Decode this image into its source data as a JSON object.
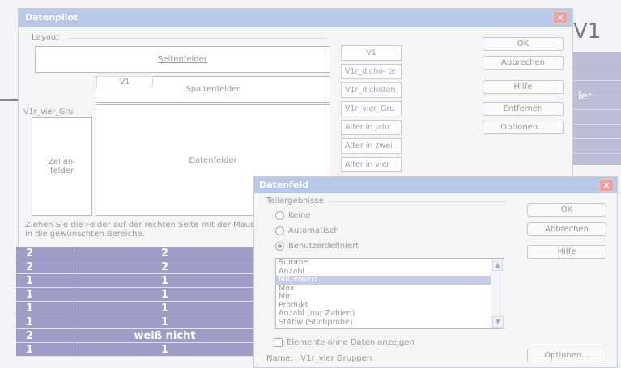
{
  "background": {
    "sheet_header": "V1",
    "sheet_col_text": "ler",
    "table_rows": [
      {
        "c1": "2",
        "c2": "2"
      },
      {
        "c1": "2",
        "c2": "2"
      },
      {
        "c1": "1",
        "c2": "1"
      },
      {
        "c1": "1",
        "c2": "1"
      },
      {
        "c1": "1",
        "c2": "1"
      },
      {
        "c1": "1",
        "c2": "1"
      },
      {
        "c1": "2",
        "c2": "weiß nicht"
      },
      {
        "c1": "1",
        "c2": "1"
      }
    ]
  },
  "datenpilot": {
    "title": "Datenpilot",
    "layout_label": "Layout",
    "seitenfelder": "Seitenfelder",
    "spaltenfelder": "Spaltenfelder",
    "column_field_item": "V1",
    "row_field_item": "V1r_vier_Gru",
    "zeilenfelder": "Zeilen-\nfelder",
    "datenfelder": "Datenfelder",
    "hint": "Ziehen Sie die Felder auf der rechten Seite mit der Maus in die gewünschten Bereiche.",
    "field_buttons": [
      "V1",
      "V1r_dicho- te",
      "V1r_dichoton",
      "V1r_vier_Gru",
      "Alter in Jahr",
      "Alter in zwei",
      "Alter in vier"
    ],
    "buttons": {
      "ok": "OK",
      "abbrechen": "Abbrechen",
      "hilfe": "Hilfe",
      "entfernen": "Entfernen",
      "optionen": "Optionen..."
    }
  },
  "datenfeld": {
    "title": "Datenfeld",
    "teilergebnisse": "Teilergebnisse",
    "radio_keine": "Keine",
    "radio_automatisch": "Automatisch",
    "radio_benutzer": "Benutzerdefiniert",
    "list_items": [
      "Summe",
      "Anzahl",
      "Mittelwert",
      "Max",
      "Min",
      "Produkt",
      "Anzahl (nur Zahlen)",
      "StAbw (Stichprobe)"
    ],
    "selected_item": "Mittelwert",
    "checkbox_label": "Elemente ohne Daten anzeigen",
    "name_label": "Name:",
    "name_value": "V1r_vier Gruppen",
    "buttons": {
      "ok": "OK",
      "abbrechen": "Abbrechen",
      "hilfe": "Hilfe",
      "optionen": "Optionen..."
    }
  }
}
